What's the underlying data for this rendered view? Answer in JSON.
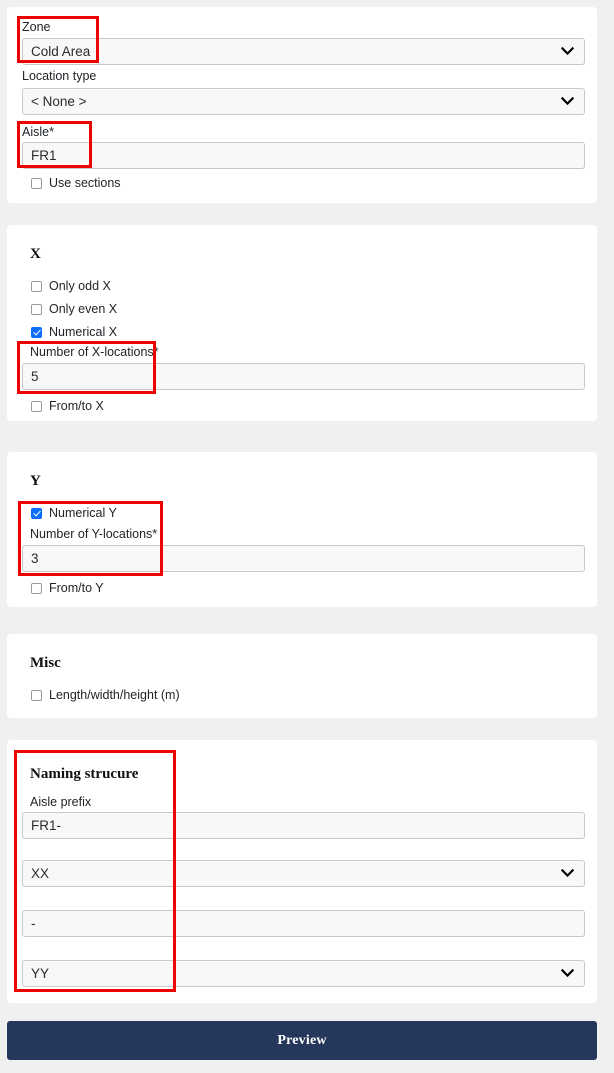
{
  "sections": {
    "location": {
      "zone": {
        "label": "Zone",
        "value": "Cold Area"
      },
      "location_type": {
        "label": "Location type",
        "value": "< None >"
      },
      "aisle": {
        "label": "Aisle*",
        "value": "FR1"
      },
      "use_sections": {
        "label": "Use sections",
        "checked": false
      }
    },
    "x": {
      "title": "X",
      "only_odd": {
        "label": "Only odd X",
        "checked": false
      },
      "only_even": {
        "label": "Only even X",
        "checked": false
      },
      "numerical": {
        "label": "Numerical X",
        "checked": true
      },
      "number_of_locations": {
        "label": "Number of X-locations*",
        "value": "5"
      },
      "from_to": {
        "label": "From/to X",
        "checked": false
      }
    },
    "y": {
      "title": "Y",
      "numerical": {
        "label": "Numerical Y",
        "checked": true
      },
      "number_of_locations": {
        "label": "Number of Y-locations*",
        "value": "3"
      },
      "from_to": {
        "label": "From/to Y",
        "checked": false
      }
    },
    "misc": {
      "title": "Misc",
      "lwh": {
        "label": "Length/width/height (m)",
        "checked": false
      }
    },
    "naming": {
      "title": "Naming strucure",
      "aisle_prefix": {
        "label": "Aisle prefix",
        "value": "FR1-"
      },
      "x_token": {
        "value": "XX"
      },
      "separator": {
        "value": "-"
      },
      "y_token": {
        "value": "YY"
      }
    }
  },
  "footer": {
    "preview_label": "Preview"
  },
  "colors": {
    "page_background": "#f0f0f0",
    "card_background": "#ffffff",
    "annotation": "#ee0000",
    "checkbox_checked": "#0d6efd",
    "preview_button": "#25375a"
  }
}
